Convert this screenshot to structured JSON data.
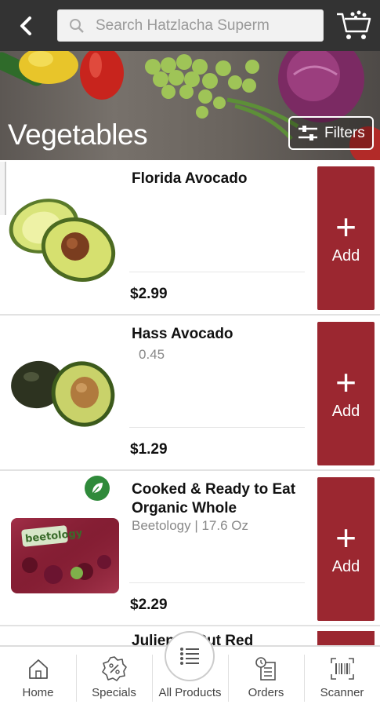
{
  "header": {
    "search_placeholder": "Search Hatzlacha Superm"
  },
  "hero": {
    "title": "Vegetables",
    "filters_label": "Filters"
  },
  "products": [
    {
      "name": "Florida Avocado",
      "subtitle": "",
      "price": "$2.99",
      "add_label": "Add"
    },
    {
      "name": "Hass Avocado",
      "subtitle": "0.45",
      "price": "$1.29",
      "add_label": "Add"
    },
    {
      "name": "Cooked & Ready to Eat Organic Whole",
      "subtitle": "Beetology | 17.6 Oz",
      "price": "$2.29",
      "add_label": "Add",
      "badge_icon": "leaf-icon",
      "image_label": "beetology"
    }
  ],
  "partial_product": {
    "name": "Julienne Cut Red"
  },
  "bottom_nav": [
    {
      "label": "Home",
      "icon": "home-icon"
    },
    {
      "label": "Specials",
      "icon": "percent-badge-icon"
    },
    {
      "label": "All Products",
      "icon": "list-icon"
    },
    {
      "label": "Orders",
      "icon": "orders-icon"
    },
    {
      "label": "Scanner",
      "icon": "barcode-icon"
    }
  ],
  "colors": {
    "topbar": "#333333",
    "add_button": "#9b2730",
    "organic_badge": "#2f8a3a"
  }
}
